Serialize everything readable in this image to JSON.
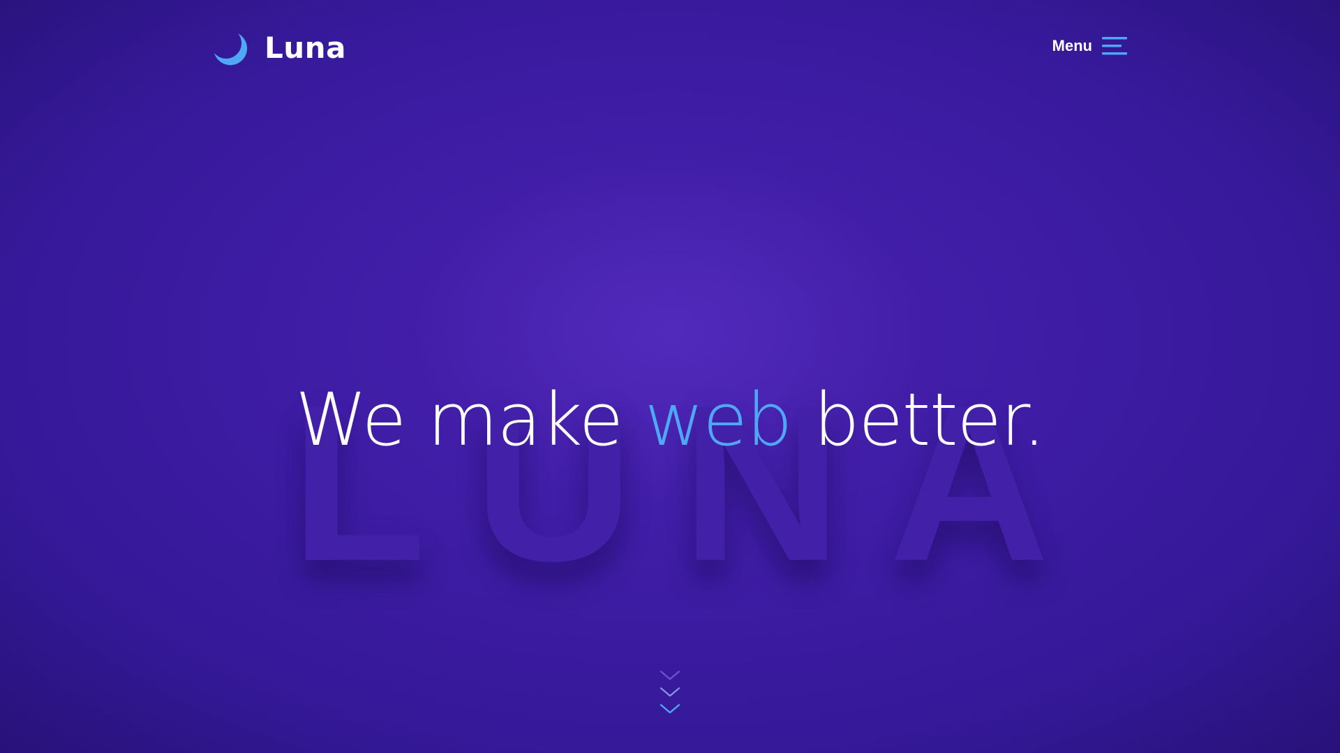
{
  "brand": {
    "name": "Luna",
    "logo_icon": "crescent-moon-icon",
    "accent_color": "#4fa7f5"
  },
  "nav": {
    "menu_label": "Menu",
    "menu_icon": "hamburger-menu-icon"
  },
  "hero": {
    "headline_prefix": "We make ",
    "headline_accent": "web",
    "headline_suffix": " better.",
    "watermark_letters": [
      "L",
      "U",
      "N",
      "A"
    ],
    "scroll_icon": "chevrons-down-icon"
  },
  "colors": {
    "background": "#3d1ca3",
    "text": "#ffffff",
    "accent": "#4fa7f5"
  }
}
